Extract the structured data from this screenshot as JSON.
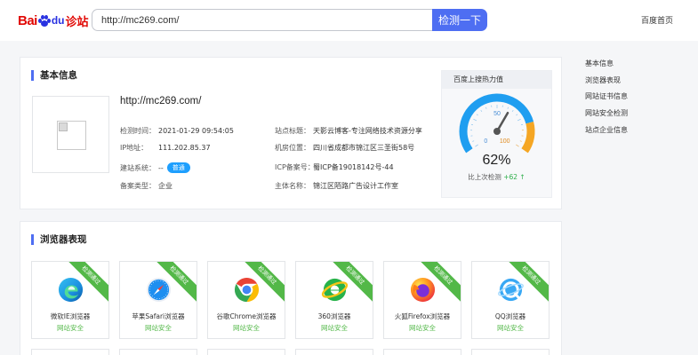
{
  "header": {
    "logo": {
      "bai": "Bai",
      "du": "du",
      "suffix": "诊站"
    },
    "search": {
      "value": "http://mc269.com/",
      "button_label": "检测一下"
    },
    "home_link": "百度首页"
  },
  "basic_info": {
    "section_title": "基本信息",
    "site_url": "http://mc269.com/",
    "left_fields": [
      {
        "label": "检测时间：",
        "value": "2021-01-29 09:54:05"
      },
      {
        "label": "IP地址：",
        "value": "111.202.85.37"
      },
      {
        "label": "建站系统：",
        "value": "--",
        "badge": "普通"
      },
      {
        "label": "备案类型：",
        "value": "企业"
      }
    ],
    "right_fields": [
      {
        "label": "站点标题：",
        "value": "天影云博客-专注网络技术资源分享"
      },
      {
        "label": "机房位置：",
        "value": "四川省成都市锦江区三圣街58号"
      },
      {
        "label": "ICP备案号：",
        "value": "蜀ICP备19018142号-44"
      },
      {
        "label": "主体名称：",
        "value": "锦江区陌路广告设计工作室"
      }
    ],
    "gauge": {
      "title": "百度上搜热力值",
      "value": 62,
      "value_label": "62%",
      "scale_labels": [
        "0",
        "50",
        "100"
      ],
      "compare_label": "比上次检测",
      "compare_value": "+62",
      "compare_arrow": "↑",
      "colors": {
        "low": "#1f9ef0",
        "high": "#f5a623",
        "needle": "#555555"
      }
    }
  },
  "side_nav": {
    "items": [
      "基本信息",
      "浏览器表现",
      "网站证书信息",
      "网站安全检测",
      "站点企业信息"
    ]
  },
  "browser_section": {
    "section_title": "浏览器表现",
    "ribbon_label": "检测通过",
    "tiles": [
      {
        "name": "微软IE浏览器",
        "status": "网站安全",
        "icon": "edge-icon"
      },
      {
        "name": "苹果Safari浏览器",
        "status": "网站安全",
        "icon": "safari-icon"
      },
      {
        "name": "谷歌Chrome浏览器",
        "status": "网站安全",
        "icon": "chrome-icon"
      },
      {
        "name": "360浏览器",
        "status": "网站安全",
        "icon": "360-browser-icon"
      },
      {
        "name": "火狐Firefox浏览器",
        "status": "网站安全",
        "icon": "firefox-icon"
      },
      {
        "name": "QQ浏览器",
        "status": "网站安全",
        "icon": "qq-browser-icon"
      }
    ]
  }
}
